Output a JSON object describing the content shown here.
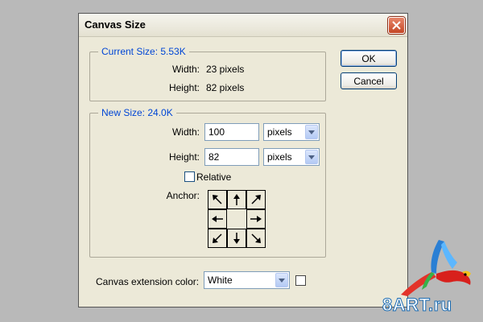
{
  "dialog": {
    "title": "Canvas Size",
    "close_icon": "close-icon",
    "ok_label": "OK",
    "cancel_label": "Cancel"
  },
  "current_size": {
    "legend": "Current Size: 5.53K",
    "width_label": "Width:",
    "width_value": "23 pixels",
    "height_label": "Height:",
    "height_value": "82 pixels"
  },
  "new_size": {
    "legend": "New Size: 24.0K",
    "width_label": "Width:",
    "width_value": "100",
    "width_unit": "pixels",
    "height_label": "Height:",
    "height_value": "82",
    "height_unit": "pixels",
    "relative_label": "Relative",
    "relative_checked": false,
    "anchor_label": "Anchor:",
    "anchor_selected": "center"
  },
  "extension": {
    "label": "Canvas extension color:",
    "value": "White",
    "swatch_color": "#ffffff"
  },
  "watermark": {
    "text": "8ART.ru"
  },
  "colors": {
    "legend_text": "#0046d5",
    "dialog_bg": "#ece9d8",
    "close_button": "#c44625",
    "page_bg": "#b9b9b9"
  }
}
